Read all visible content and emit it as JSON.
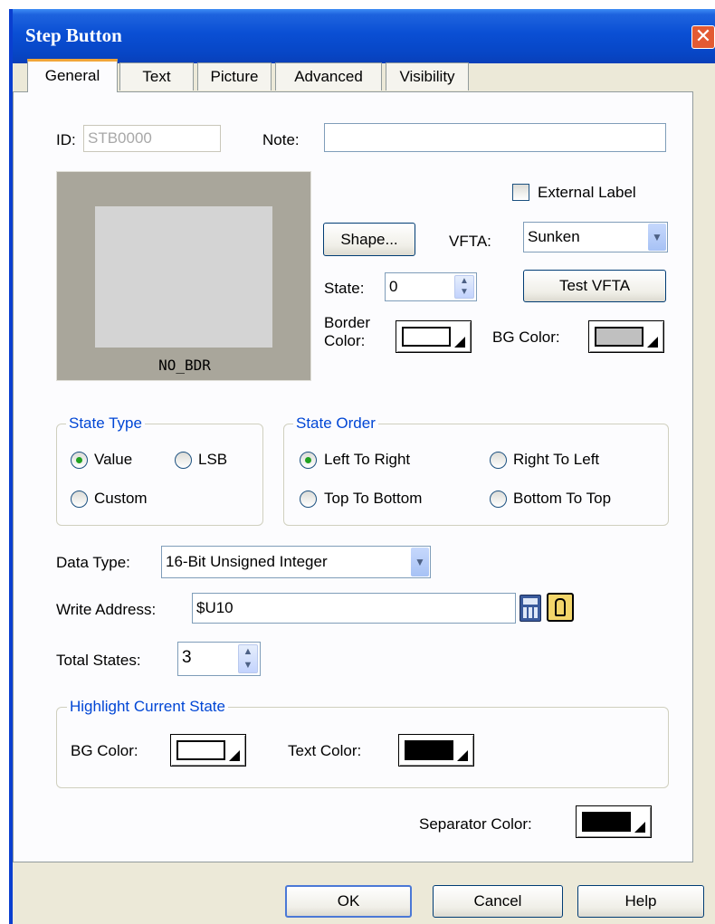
{
  "window": {
    "title": "Step Button",
    "close_glyph": "✕"
  },
  "tabs": [
    "General",
    "Text",
    "Picture",
    "Advanced",
    "Visibility"
  ],
  "general": {
    "id_label": "ID:",
    "id_value": "STB0000",
    "note_label": "Note:",
    "note_value": "",
    "preview_caption": "NO_BDR",
    "external_label": "External Label",
    "external_label_checked": false,
    "shape_button": "Shape...",
    "vfta_label": "VFTA:",
    "vfta_value": "Sunken",
    "state_label": "State:",
    "state_value": "0",
    "test_vfta_button": "Test VFTA",
    "border_color_label_1": "Border",
    "border_color_label_2": "Color:",
    "bg_color_label": "BG Color:",
    "colors": {
      "border": "#ffffff",
      "bg": "#c0c0c0",
      "preview_frame": "#a9a69b",
      "preview_face": "#d4d4d4"
    }
  },
  "state_type": {
    "title": "State Type",
    "options": [
      "Value",
      "LSB",
      "Custom"
    ],
    "selected": "Value"
  },
  "state_order": {
    "title": "State Order",
    "options": [
      "Left To Right",
      "Right To Left",
      "Top To Bottom",
      "Bottom To Top"
    ],
    "selected": "Left To Right"
  },
  "data_type": {
    "label": "Data Type:",
    "value": "16-Bit Unsigned Integer"
  },
  "write_address": {
    "label": "Write Address:",
    "value": "$U10"
  },
  "total_states": {
    "label": "Total States:",
    "value": "3"
  },
  "highlight": {
    "title": "Highlight Current State",
    "bg_color_label": "BG Color:",
    "text_color_label": "Text Color:",
    "colors": {
      "bg": "#ffffff",
      "text": "#000000"
    }
  },
  "separator": {
    "label": "Separator Color:",
    "color": "#000000"
  },
  "buttons": {
    "ok": "OK",
    "cancel": "Cancel",
    "help": "Help"
  }
}
